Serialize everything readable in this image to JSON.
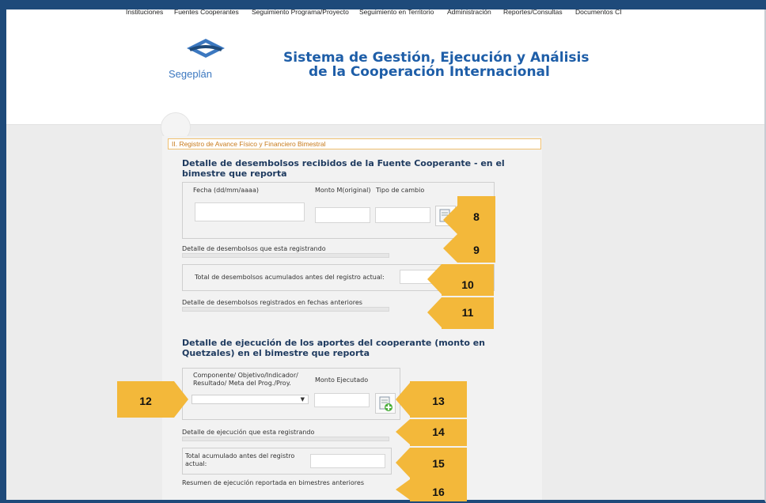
{
  "header": {
    "logo_text": "Segeplán",
    "title_line1": "Sistema de Gestión, Ejecución y Análisis",
    "title_line2": "de la Cooperación Internacional"
  },
  "nav": {
    "items": [
      "Instituciones",
      "Fuentes Cooperantes",
      "Seguimiento Programa/Proyecto",
      "Seguimiento en Territorio",
      "Administración",
      "Reportes/Consultas",
      "Documentos CI"
    ]
  },
  "section": {
    "title": "II. Registro de Avance Físico y Financiero Bimestral"
  },
  "desembolsos": {
    "heading": "Detalle de desembolsos recibidos de la Fuente Cooperante - en el bimestre que reporta",
    "col_fecha": "Fecha (dd/mm/aaaa)",
    "col_monto": "Monto M(original)",
    "col_tipo": "Tipo de cambio",
    "fecha_value": "",
    "monto_value": "",
    "tipo_value": "",
    "registrando_label": "Detalle de desembolsos que esta registrando",
    "total_label": "Total de desembolsos acumulados antes del registro actual:",
    "total_value": "",
    "anteriores_label": "Detalle de desembolsos registrados en fechas anteriores"
  },
  "ejecucion": {
    "heading": "Detalle de ejecución de los aportes del cooperante (monto en Quetzales) en el bimestre que reporta",
    "col_componente": "Componente/ Objetivo/Indicador/ Resultado/ Meta del Prog./Proy.",
    "col_monto": "Monto Ejecutado",
    "componente_selected": "",
    "monto_value": "",
    "registrando_label": "Detalle de ejecución que esta registrando",
    "total_label": "Total acumulado antes del registro actual:",
    "total_value": "",
    "resumen_label": "Resumen de ejecución reportada en bimestres anteriores"
  },
  "callouts": [
    "8",
    "9",
    "10",
    "11",
    "12",
    "13",
    "14",
    "15",
    "16"
  ],
  "colors": {
    "frame": "#1e4a7a",
    "title": "#1e5ea8",
    "callout": "#f3b83a",
    "section_title": "#c87a1a",
    "heading": "#1e3a5f"
  },
  "icons": {
    "add": "add-green-plus-icon",
    "select_arrow": "chevron-down-icon"
  }
}
